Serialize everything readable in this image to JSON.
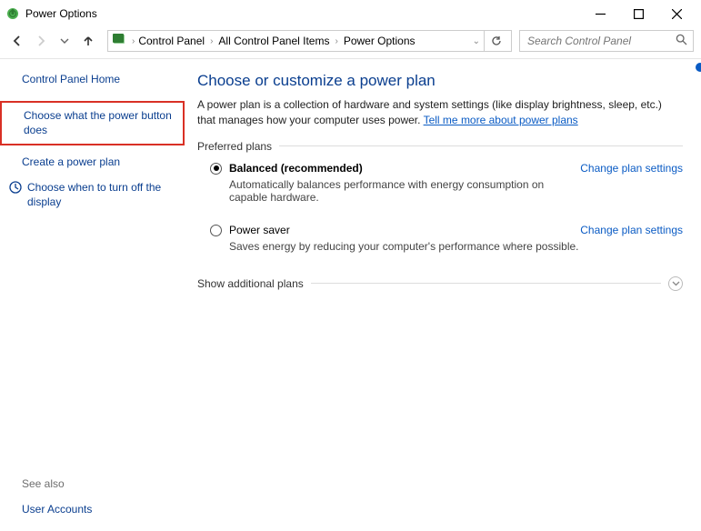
{
  "window": {
    "title": "Power Options"
  },
  "breadcrumb": {
    "items": [
      "Control Panel",
      "All Control Panel Items",
      "Power Options"
    ]
  },
  "search": {
    "placeholder": "Search Control Panel"
  },
  "sidebar": {
    "home": "Control Panel Home",
    "highlighted": "Choose what the power button does",
    "create": "Create a power plan",
    "turnoff": "Choose when to turn off the display",
    "seealso_header": "See also",
    "seealso_link": "User Accounts"
  },
  "main": {
    "heading": "Choose or customize a power plan",
    "description_prefix": "A power plan is a collection of hardware and system settings (like display brightness, sleep, etc.) that manages how your computer uses power. ",
    "description_link": "Tell me more about power plans",
    "preferred_label": "Preferred plans",
    "plans": [
      {
        "name": "Balanced (recommended)",
        "sub": "Automatically balances performance with energy consumption on capable hardware.",
        "change": "Change plan settings",
        "selected": true
      },
      {
        "name": "Power saver",
        "sub": "Saves energy by reducing your computer's performance where possible.",
        "change": "Change plan settings",
        "selected": false
      }
    ],
    "additional": "Show additional plans"
  }
}
